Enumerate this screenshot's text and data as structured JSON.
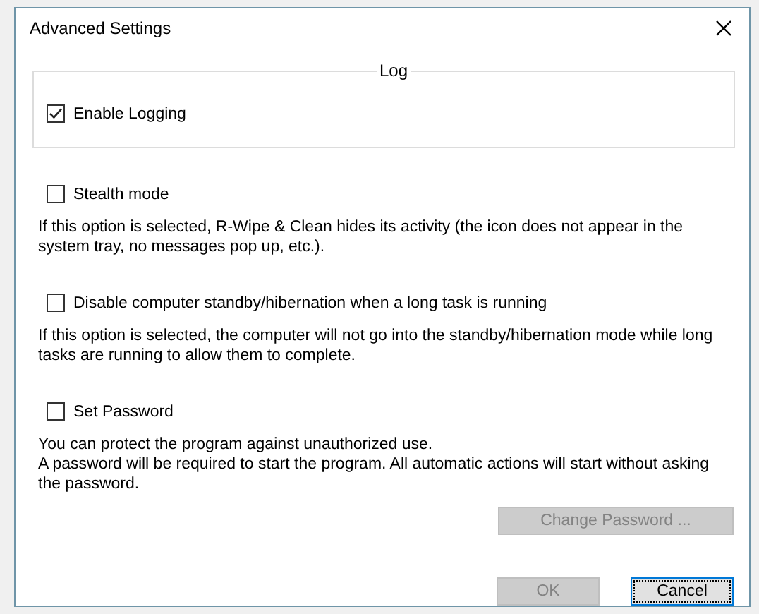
{
  "window": {
    "title": "Advanced Settings"
  },
  "log_group": {
    "title": "Log",
    "option": {
      "label": "Enable Logging",
      "checked": true
    }
  },
  "options": [
    {
      "label": "Stealth mode",
      "checked": false,
      "description": "If this option is selected, R-Wipe & Clean hides its activity (the icon does not appear in the system tray, no messages pop up, etc.)."
    },
    {
      "label": "Disable computer standby/hibernation when a long task is running",
      "checked": false,
      "description": "If this option is selected, the computer will not go into the standby/hibernation mode while long tasks are running to allow them to complete."
    },
    {
      "label": "Set Password",
      "checked": false,
      "description": "You can protect the program against unauthorized use.\nA password will be required to start the program. All automatic actions will start without asking the password."
    }
  ],
  "change_password_button": {
    "label": "Change Password ...",
    "disabled": true
  },
  "buttons": [
    {
      "label": "OK",
      "disabled": true,
      "default": false
    },
    {
      "label": "Cancel",
      "disabled": false,
      "default": true
    }
  ]
}
